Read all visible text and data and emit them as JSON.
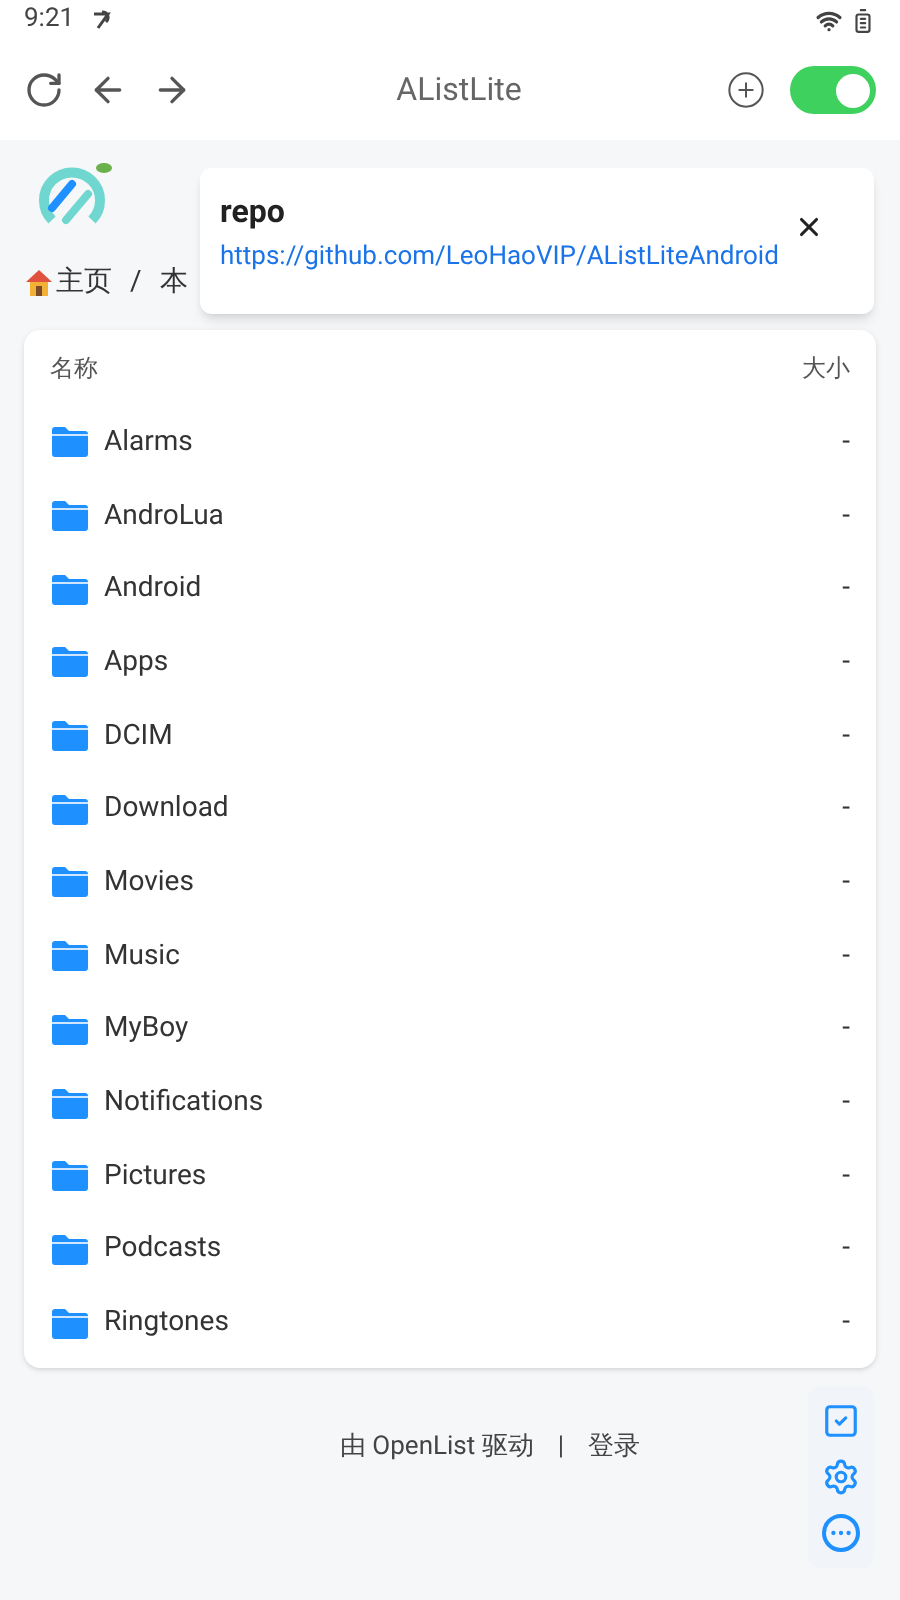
{
  "status_bar": {
    "time": "9:21"
  },
  "toolbar": {
    "title": "AListLite",
    "switch": {
      "on": true
    }
  },
  "breadcrumb": [
    "主页",
    "本"
  ],
  "breadcrumb_separator": "/",
  "popup": {
    "title": "repo",
    "link": "https://github.com/LeoHaoVIP/AListLiteAndroid"
  },
  "table": {
    "columns": [
      "名称",
      "大小"
    ],
    "rows": [
      {
        "name": "Alarms",
        "size": "-"
      },
      {
        "name": "AndroLua",
        "size": "-"
      },
      {
        "name": "Android",
        "size": "-"
      },
      {
        "name": "Apps",
        "size": "-"
      },
      {
        "name": "DCIM",
        "size": "-"
      },
      {
        "name": "Download",
        "size": "-"
      },
      {
        "name": "Movies",
        "size": "-"
      },
      {
        "name": "Music",
        "size": "-"
      },
      {
        "name": "MyBoy",
        "size": "-"
      },
      {
        "name": "Notifications",
        "size": "-"
      },
      {
        "name": "Pictures",
        "size": "-"
      },
      {
        "name": "Podcasts",
        "size": "-"
      },
      {
        "name": "Ringtones",
        "size": "-"
      }
    ]
  },
  "footer": {
    "powered": "由 OpenList 驱动",
    "separator": "|",
    "login": "登录"
  }
}
